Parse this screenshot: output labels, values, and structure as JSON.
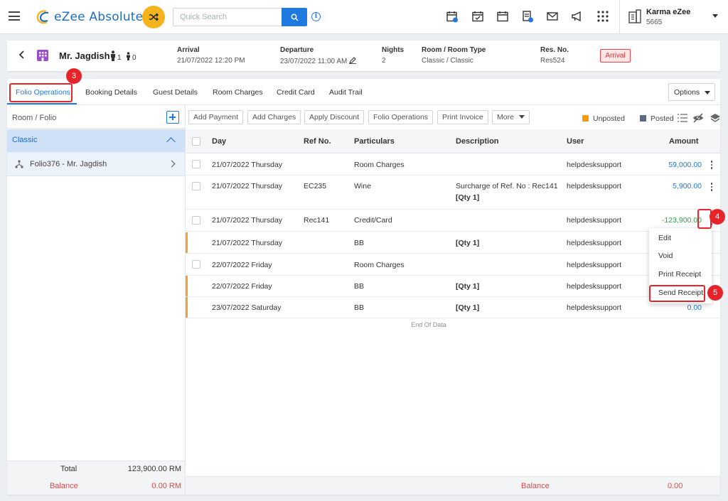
{
  "app": {
    "brand": "eZee Absolute"
  },
  "search": {
    "placeholder": "Quick Search"
  },
  "property": {
    "name": "Karma eZee",
    "code": "5665"
  },
  "booking": {
    "guest_name": "Mr. Jagdish",
    "adults": "1",
    "children": "0",
    "arrival_label": "Arrival",
    "arrival_value": "21/07/2022 12:20 PM",
    "departure_label": "Departure",
    "departure_value": "23/07/2022 11:00 AM",
    "nights_label": "Nights",
    "nights_value": "2",
    "room_label": "Room / Room Type",
    "room_value": "Classic / Classic",
    "resno_label": "Res. No.",
    "resno_value": "Res524",
    "status": "Arrival"
  },
  "tabs": [
    {
      "label": "Folio Operations"
    },
    {
      "label": "Booking Details"
    },
    {
      "label": "Guest Details"
    },
    {
      "label": "Room Charges"
    },
    {
      "label": "Credit Card"
    },
    {
      "label": "Audit Trail"
    }
  ],
  "options_label": "Options",
  "left_panel": {
    "header": "Room / Folio",
    "room_group": "Classic",
    "folio": "Folio376 - Mr. Jagdish",
    "total_label": "Total",
    "total_value": "123,900.00 RM",
    "balance_label": "Balance",
    "balance_value": "0.00 RM"
  },
  "actions": [
    "Add Payment",
    "Add Charges",
    "Apply Discount",
    "Folio Operations",
    "Print Invoice",
    "More"
  ],
  "legend": {
    "unposted": "Unposted",
    "posted": "Posted"
  },
  "table": {
    "headers": [
      "Day",
      "Ref No.",
      "Particulars",
      "Description",
      "User",
      "Amount"
    ],
    "rows": [
      {
        "day": "21/07/2022 Thursday",
        "ref": "",
        "particulars": "Room Charges",
        "description": "",
        "qty": "",
        "user": "helpdesksupport",
        "amount": "59,000.00"
      },
      {
        "day": "21/07/2022 Thursday",
        "ref": "EC235",
        "particulars": "Wine",
        "description": "Surcharge of Ref. No : Rec141",
        "qty": "[Qty 1]",
        "user": "helpdesksupport",
        "amount": "5,900.00"
      },
      {
        "day": "21/07/2022 Thursday",
        "ref": "Rec141",
        "particulars": "Credit/Card",
        "description": "",
        "qty": "",
        "user": "helpdesksupport",
        "amount": "-123,900.00"
      },
      {
        "day": "21/07/2022 Thursday",
        "ref": "",
        "particulars": "BB",
        "description": "",
        "qty": "[Qty 1]",
        "user": "helpdesksupport",
        "amount": ""
      },
      {
        "day": "22/07/2022 Friday",
        "ref": "",
        "particulars": "Room Charges",
        "description": "",
        "qty": "",
        "user": "helpdesksupport",
        "amount": ""
      },
      {
        "day": "22/07/2022 Friday",
        "ref": "",
        "particulars": "BB",
        "description": "",
        "qty": "[Qty 1]",
        "user": "helpdesksupport",
        "amount": ""
      },
      {
        "day": "23/07/2022 Saturday",
        "ref": "",
        "particulars": "BB",
        "description": "",
        "qty": "[Qty 1]",
        "user": "helpdesksupport",
        "amount": "0.00"
      }
    ],
    "end_text": "End Of Data",
    "balance_label": "Balance",
    "balance_value": "0.00"
  },
  "menu": [
    "Edit",
    "Void",
    "Print Receipt",
    "Send Receipt"
  ],
  "annotations": {
    "step3": "3",
    "step4": "4",
    "step5": "5"
  },
  "colors": {
    "accent": "#1f7ae0",
    "unposted": "#f39c12",
    "posted": "#5a6b7d",
    "negative": "#27a844",
    "danger": "#e8242b"
  }
}
